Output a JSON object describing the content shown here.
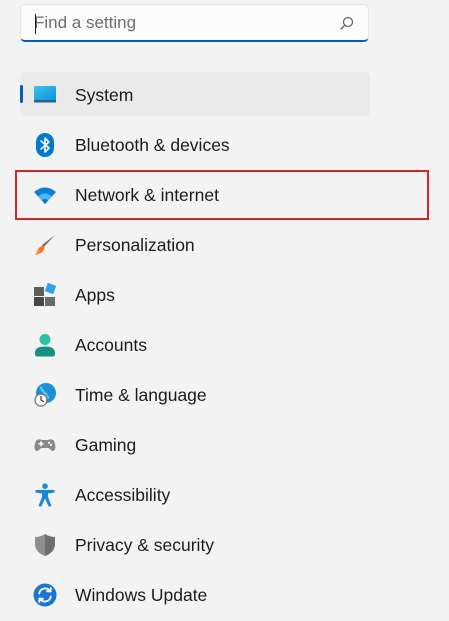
{
  "search": {
    "placeholder": "Find a setting",
    "value": ""
  },
  "nav": {
    "selected": "System",
    "highlighted": "Network & internet",
    "highlight_color": "#d9242b",
    "accent_color": "#005fb8",
    "items": [
      {
        "label": "System",
        "icon": "monitor-icon"
      },
      {
        "label": "Bluetooth & devices",
        "icon": "bluetooth-icon"
      },
      {
        "label": "Network & internet",
        "icon": "wifi-icon"
      },
      {
        "label": "Personalization",
        "icon": "paintbrush-icon"
      },
      {
        "label": "Apps",
        "icon": "apps-icon"
      },
      {
        "label": "Accounts",
        "icon": "person-icon"
      },
      {
        "label": "Time & language",
        "icon": "globe-clock-icon"
      },
      {
        "label": "Gaming",
        "icon": "gamepad-icon"
      },
      {
        "label": "Accessibility",
        "icon": "accessibility-icon"
      },
      {
        "label": "Privacy & security",
        "icon": "shield-icon"
      },
      {
        "label": "Windows Update",
        "icon": "update-icon"
      }
    ]
  }
}
